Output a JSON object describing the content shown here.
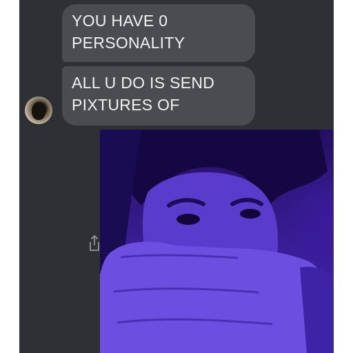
{
  "messages": [
    {
      "text": "YOU HAVE 0\nPERSONALITY"
    },
    {
      "text": "ALL U DO IS SEND\nPIXTURES OF"
    }
  ],
  "sender": {
    "avatar_icon": "sender-avatar"
  },
  "actions": {
    "share_icon": "share-icon"
  },
  "attachment": {
    "type": "photo",
    "subject": "selfie-photo"
  },
  "colors": {
    "panel_background": "#2e3034",
    "bubble_background": "#4a4c50",
    "bubble_text": "#f2f2f2",
    "photo_tint": "#3a1d98"
  }
}
